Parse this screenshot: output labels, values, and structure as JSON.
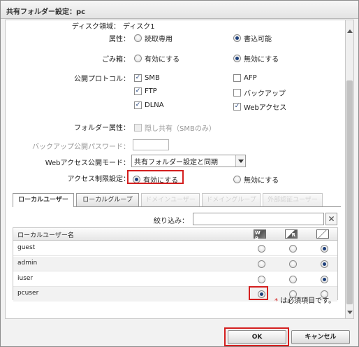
{
  "dialog": {
    "title": "共有フォルダー設定：pc"
  },
  "form": {
    "disk_label": "ディスク領域：",
    "disk_value": "ディスク1",
    "attribute_label": "属性：",
    "attribute_options": [
      "読取専用",
      "書込可能"
    ],
    "attribute_selected": "書込可能",
    "trash_label": "ごみ箱：",
    "trash_options": [
      "有効にする",
      "無効にする"
    ],
    "trash_selected": "無効にする",
    "protocol_label": "公開プロトコル：",
    "protocols": [
      {
        "label": "SMB",
        "checked": true
      },
      {
        "label": "AFP",
        "checked": false
      },
      {
        "label": "FTP",
        "checked": true
      },
      {
        "label": "バックアップ",
        "checked": false
      },
      {
        "label": "DLNA",
        "checked": true
      },
      {
        "label": "Webアクセス",
        "checked": true
      }
    ],
    "folder_attr_label": "フォルダー属性：",
    "folder_attr_option": "隠し共有（SMBのみ）",
    "backup_password_label": "バックアップ公開パスワード：",
    "backup_password_value": "",
    "web_mode_label": "Webアクセス公開モード：",
    "web_mode_value": "共有フォルダー設定と同期",
    "access_label": "アクセス制限設定：",
    "access_options": [
      "有効にする",
      "無効にする"
    ],
    "access_selected": "有効にする"
  },
  "tabs": [
    {
      "label": "ローカルユーザー",
      "active": true,
      "enabled": true
    },
    {
      "label": "ローカルグループ",
      "active": false,
      "enabled": true
    },
    {
      "label": "ドメインユーザー",
      "active": false,
      "enabled": false
    },
    {
      "label": "ドメイングループ",
      "active": false,
      "enabled": false
    },
    {
      "label": "外部認証ユーザー",
      "active": false,
      "enabled": false
    }
  ],
  "filter": {
    "label": "絞り込み：",
    "value": "",
    "clear_label": "✕"
  },
  "table": {
    "column_name": "ローカルユーザー名",
    "perm_icons": [
      "read-write-icon",
      "read-only-icon",
      "no-access-icon"
    ],
    "perm_badges": [
      "W R",
      "R",
      ""
    ],
    "rows": [
      {
        "name": "guest",
        "permission": "none"
      },
      {
        "name": "admin",
        "permission": "none"
      },
      {
        "name": "iuser",
        "permission": "none"
      },
      {
        "name": "pcuser",
        "permission": "rw"
      }
    ]
  },
  "footer": {
    "required_star": "*",
    "required_note": "は必須項目です。",
    "ok_label": "OK",
    "cancel_label": "キャンセル"
  },
  "colors": {
    "highlight": "#d41f1f",
    "radio_selected": "#1d3f7a"
  }
}
